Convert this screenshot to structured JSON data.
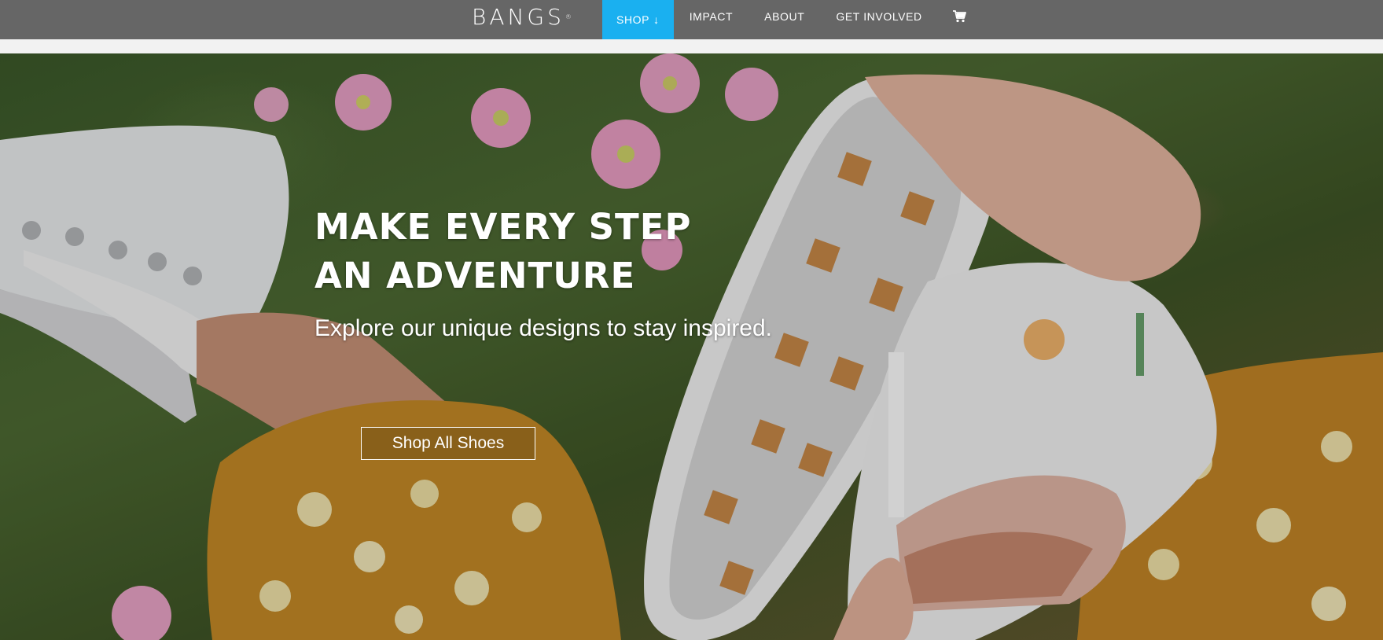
{
  "header": {
    "logo": "BANGS",
    "logo_mark": "®",
    "nav": [
      {
        "label": "SHOP",
        "active": true,
        "has_arrow": true,
        "arrow": "↓"
      },
      {
        "label": "IMPACT",
        "active": false
      },
      {
        "label": "ABOUT",
        "active": false
      },
      {
        "label": "GET INVOLVED",
        "active": false
      }
    ],
    "cart_icon": "cart-icon",
    "colors": {
      "bar": "#666666",
      "active": "#1ab0f0",
      "text": "#ffffff"
    }
  },
  "hero": {
    "headline_line1": "MAKE EVERY STEP",
    "headline_line2": "AN ADVENTURE",
    "subheadline": "Explore our unique designs to stay inspired.",
    "cta_label": "Shop All Shoes"
  }
}
